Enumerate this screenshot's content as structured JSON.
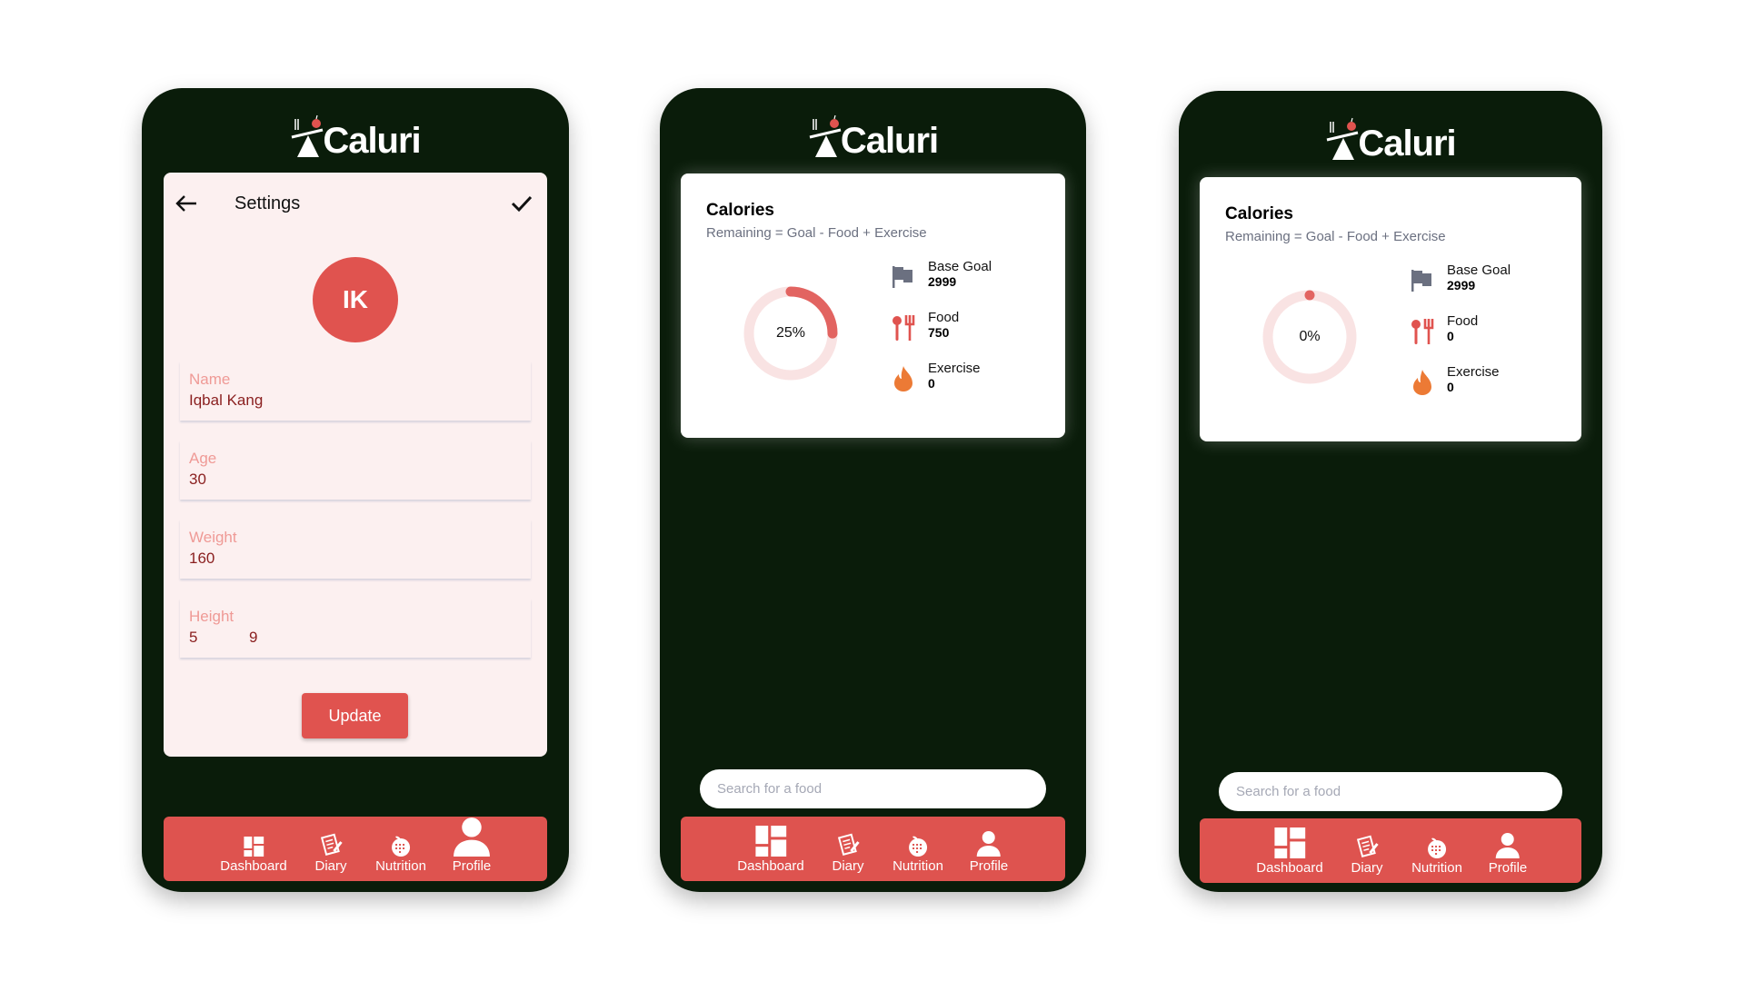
{
  "app": {
    "name": "Caluri"
  },
  "colors": {
    "background": "#0a1c0a",
    "accent": "#e0534f",
    "card_pink": "#fcf0f0",
    "ring_track": "#f9e3e3",
    "flame": "#ec7a35",
    "flag": "#6b7080"
  },
  "settings_screen": {
    "title": "Settings",
    "avatar_initials": "IK",
    "fields": [
      {
        "label": "Name",
        "value": "Iqbal Kang"
      },
      {
        "label": "Age",
        "value": "30"
      },
      {
        "label": "Weight",
        "value": "160"
      },
      {
        "label": "Height",
        "value_feet": "5",
        "value_inches": "9"
      }
    ],
    "update_label": "Update"
  },
  "nav": {
    "items": [
      {
        "label": "Dashboard",
        "icon": "dashboard-icon"
      },
      {
        "label": "Diary",
        "icon": "diary-icon"
      },
      {
        "label": "Nutrition",
        "icon": "nutrition-icon"
      },
      {
        "label": "Profile",
        "icon": "profile-icon"
      }
    ]
  },
  "dashboards": [
    {
      "title": "Calories",
      "subtitle": "Remaining = Goal - Food + Exercise",
      "percent": 25,
      "percent_label": "25%",
      "legend": [
        {
          "name": "Base Goal",
          "value": "2999",
          "icon": "flag-icon"
        },
        {
          "name": "Food",
          "value": "750",
          "icon": "utensils-icon"
        },
        {
          "name": "Exercise",
          "value": "0",
          "icon": "flame-icon"
        }
      ],
      "search_placeholder": "Search for a food"
    },
    {
      "title": "Calories",
      "subtitle": "Remaining = Goal - Food + Exercise",
      "percent": 0,
      "percent_label": "0%",
      "legend": [
        {
          "name": "Base Goal",
          "value": "2999",
          "icon": "flag-icon"
        },
        {
          "name": "Food",
          "value": "0",
          "icon": "utensils-icon"
        },
        {
          "name": "Exercise",
          "value": "0",
          "icon": "flame-icon"
        }
      ],
      "search_placeholder": "Search for a food"
    }
  ]
}
